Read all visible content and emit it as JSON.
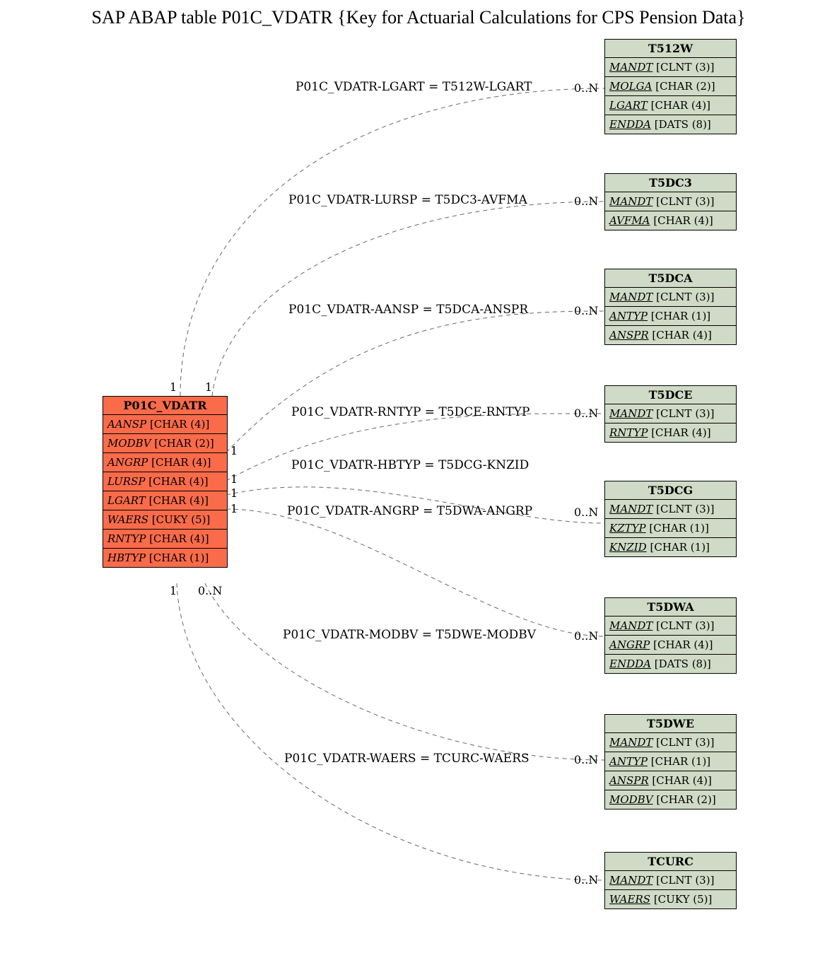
{
  "title": "SAP ABAP table P01C_VDATR {Key for Actuarial Calculations for CPS Pension Data}",
  "main": {
    "name": "P01C_VDATR",
    "fields": [
      {
        "name": "AANSP",
        "type": "[CHAR (4)]"
      },
      {
        "name": "MODBV",
        "type": "[CHAR (2)]"
      },
      {
        "name": "ANGRP",
        "type": "[CHAR (4)]"
      },
      {
        "name": "LURSP",
        "type": "[CHAR (4)]"
      },
      {
        "name": "LGART",
        "type": "[CHAR (4)]"
      },
      {
        "name": "WAERS",
        "type": "[CUKY (5)]"
      },
      {
        "name": "RNTYP",
        "type": "[CHAR (4)]"
      },
      {
        "name": "HBTYP",
        "type": "[CHAR (1)]"
      }
    ]
  },
  "refs": [
    {
      "name": "T512W",
      "fields": [
        {
          "name": "MANDT",
          "type": "[CLNT (3)]",
          "ul": true
        },
        {
          "name": "MOLGA",
          "type": "[CHAR (2)]",
          "ul": true
        },
        {
          "name": "LGART",
          "type": "[CHAR (4)]",
          "ul": true
        },
        {
          "name": "ENDDA",
          "type": "[DATS (8)]",
          "ul": true
        }
      ]
    },
    {
      "name": "T5DC3",
      "fields": [
        {
          "name": "MANDT",
          "type": "[CLNT (3)]",
          "ul": true
        },
        {
          "name": "AVFMA",
          "type": "[CHAR (4)]",
          "ul": true
        }
      ]
    },
    {
      "name": "T5DCA",
      "fields": [
        {
          "name": "MANDT",
          "type": "[CLNT (3)]",
          "ul": true
        },
        {
          "name": "ANTYP",
          "type": "[CHAR (1)]",
          "ul": true
        },
        {
          "name": "ANSPR",
          "type": "[CHAR (4)]",
          "ul": true
        }
      ]
    },
    {
      "name": "T5DCE",
      "fields": [
        {
          "name": "MANDT",
          "type": "[CLNT (3)]",
          "ul": true
        },
        {
          "name": "RNTYP",
          "type": "[CHAR (4)]",
          "ul": true
        }
      ]
    },
    {
      "name": "T5DCG",
      "fields": [
        {
          "name": "MANDT",
          "type": "[CLNT (3)]",
          "ul": true
        },
        {
          "name": "KZTYP",
          "type": "[CHAR (1)]",
          "ul": true
        },
        {
          "name": "KNZID",
          "type": "[CHAR (1)]",
          "ul": true
        }
      ]
    },
    {
      "name": "T5DWA",
      "fields": [
        {
          "name": "MANDT",
          "type": "[CLNT (3)]",
          "ul": true
        },
        {
          "name": "ANGRP",
          "type": "[CHAR (4)]",
          "ul": true
        },
        {
          "name": "ENDDA",
          "type": "[DATS (8)]",
          "ul": true
        }
      ]
    },
    {
      "name": "T5DWE",
      "fields": [
        {
          "name": "MANDT",
          "type": "[CLNT (3)]",
          "ul": true
        },
        {
          "name": "ANTYP",
          "type": "[CHAR (1)]",
          "ul": true
        },
        {
          "name": "ANSPR",
          "type": "[CHAR (4)]",
          "ul": true
        },
        {
          "name": "MODBV",
          "type": "[CHAR (2)]",
          "ul": true
        }
      ]
    },
    {
      "name": "TCURC",
      "fields": [
        {
          "name": "MANDT",
          "type": "[CLNT (3)]",
          "ul": true
        },
        {
          "name": "WAERS",
          "type": "[CUKY (5)]",
          "ul": true
        }
      ]
    }
  ],
  "edges": [
    {
      "label": "P01C_VDATR-LGART = T512W-LGART",
      "card_r": "0..N"
    },
    {
      "label": "P01C_VDATR-LURSP = T5DC3-AVFMA",
      "card_r": "0..N"
    },
    {
      "label": "P01C_VDATR-AANSP = T5DCA-ANSPR",
      "card_r": "0..N"
    },
    {
      "label": "P01C_VDATR-RNTYP = T5DCE-RNTYP",
      "card_r": "0..N"
    },
    {
      "label": "P01C_VDATR-HBTYP = T5DCG-KNZID",
      "card_r": ""
    },
    {
      "label": "P01C_VDATR-ANGRP = T5DWA-ANGRP",
      "card_r": "0..N"
    },
    {
      "label": "P01C_VDATR-MODBV = T5DWE-MODBV",
      "card_r": "0..N"
    },
    {
      "label": "P01C_VDATR-WAERS = TCURC-WAERS",
      "card_r": "0..N"
    }
  ],
  "main_cards": [
    "1",
    "1",
    "1",
    "1",
    "1",
    "1",
    "1",
    "0..N"
  ]
}
